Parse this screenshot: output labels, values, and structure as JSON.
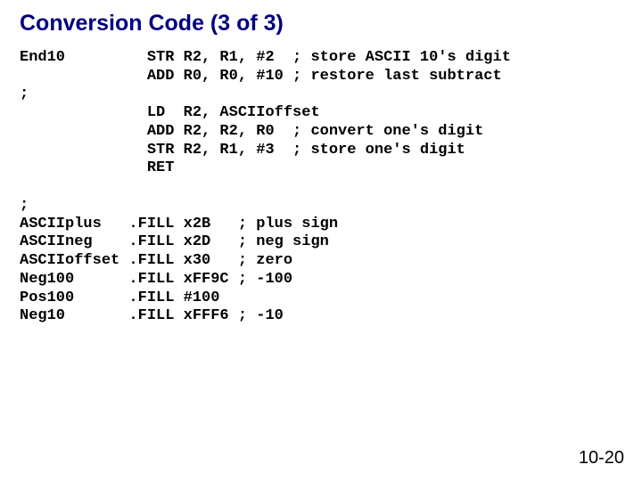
{
  "title": "Conversion Code (3 of 3)",
  "code_lines": [
    "End10         STR R2, R1, #2  ; store ASCII 10's digit",
    "              ADD R0, R0, #10 ; restore last subtract",
    ";",
    "              LD  R2, ASCIIoffset",
    "              ADD R2, R2, R0  ; convert one's digit",
    "              STR R2, R1, #3  ; store one's digit",
    "              RET",
    "",
    ";",
    "ASCIIplus   .FILL x2B   ; plus sign",
    "ASCIIneg    .FILL x2D   ; neg sign",
    "ASCIIoffset .FILL x30   ; zero",
    "Neg100      .FILL xFF9C ; -100",
    "Pos100      .FILL #100",
    "Neg10       .FILL xFFF6 ; -10"
  ],
  "page_number": "10-20"
}
